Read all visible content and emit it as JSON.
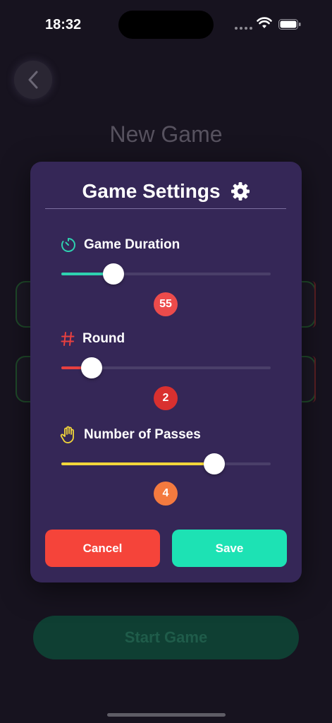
{
  "status_bar": {
    "time": "18:32"
  },
  "background": {
    "title": "New Game",
    "start_button_label": "Start Game"
  },
  "modal": {
    "title": "Game Settings",
    "settings": [
      {
        "label": "Game Duration",
        "icon": "timer-icon",
        "value": "55",
        "fraction": 0.25,
        "color": "#2ed1b0",
        "badge_color": "#ec4b4b"
      },
      {
        "label": "Round",
        "icon": "hash-icon",
        "value": "2",
        "fraction": 0.145,
        "color": "#e8403f",
        "badge_color": "#d9302f"
      },
      {
        "label": "Number of Passes",
        "icon": "hand-icon",
        "value": "4",
        "fraction": 0.73,
        "color": "#f3d63a",
        "badge_color": "#f47a3f"
      }
    ],
    "cancel_label": "Cancel",
    "save_label": "Save"
  },
  "colors": {
    "modal_bg": "#352757",
    "cancel": "#f5443a",
    "save": "#1de2b4",
    "screen_bg": "#17131f"
  }
}
